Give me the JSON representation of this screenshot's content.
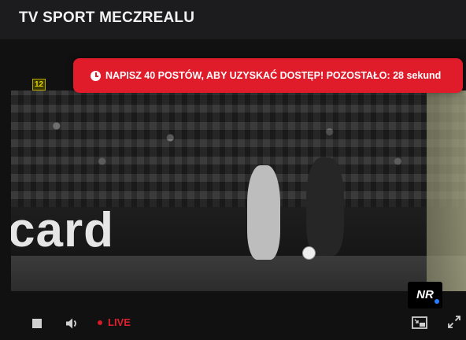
{
  "header": {
    "title": "TV SPORT MECZREALU"
  },
  "player": {
    "age_rating": "12",
    "alert": {
      "icon": "clock-icon",
      "text": "NAPISZ 40 POSTÓW, ABY UZYSKAĆ DOSTĘP! POZOSTAŁO: 28 sekund"
    },
    "board_text": "card",
    "logo_text": "NR",
    "controls": {
      "stop_icon": "stop-icon",
      "volume_icon": "volume-icon",
      "live_label": "LIVE",
      "pip_icon": "picture-in-picture-icon",
      "fullscreen_icon": "fullscreen-icon"
    }
  },
  "colors": {
    "alert": "#e01c2b",
    "live": "#e0202f",
    "background": "#1c1c1e"
  }
}
